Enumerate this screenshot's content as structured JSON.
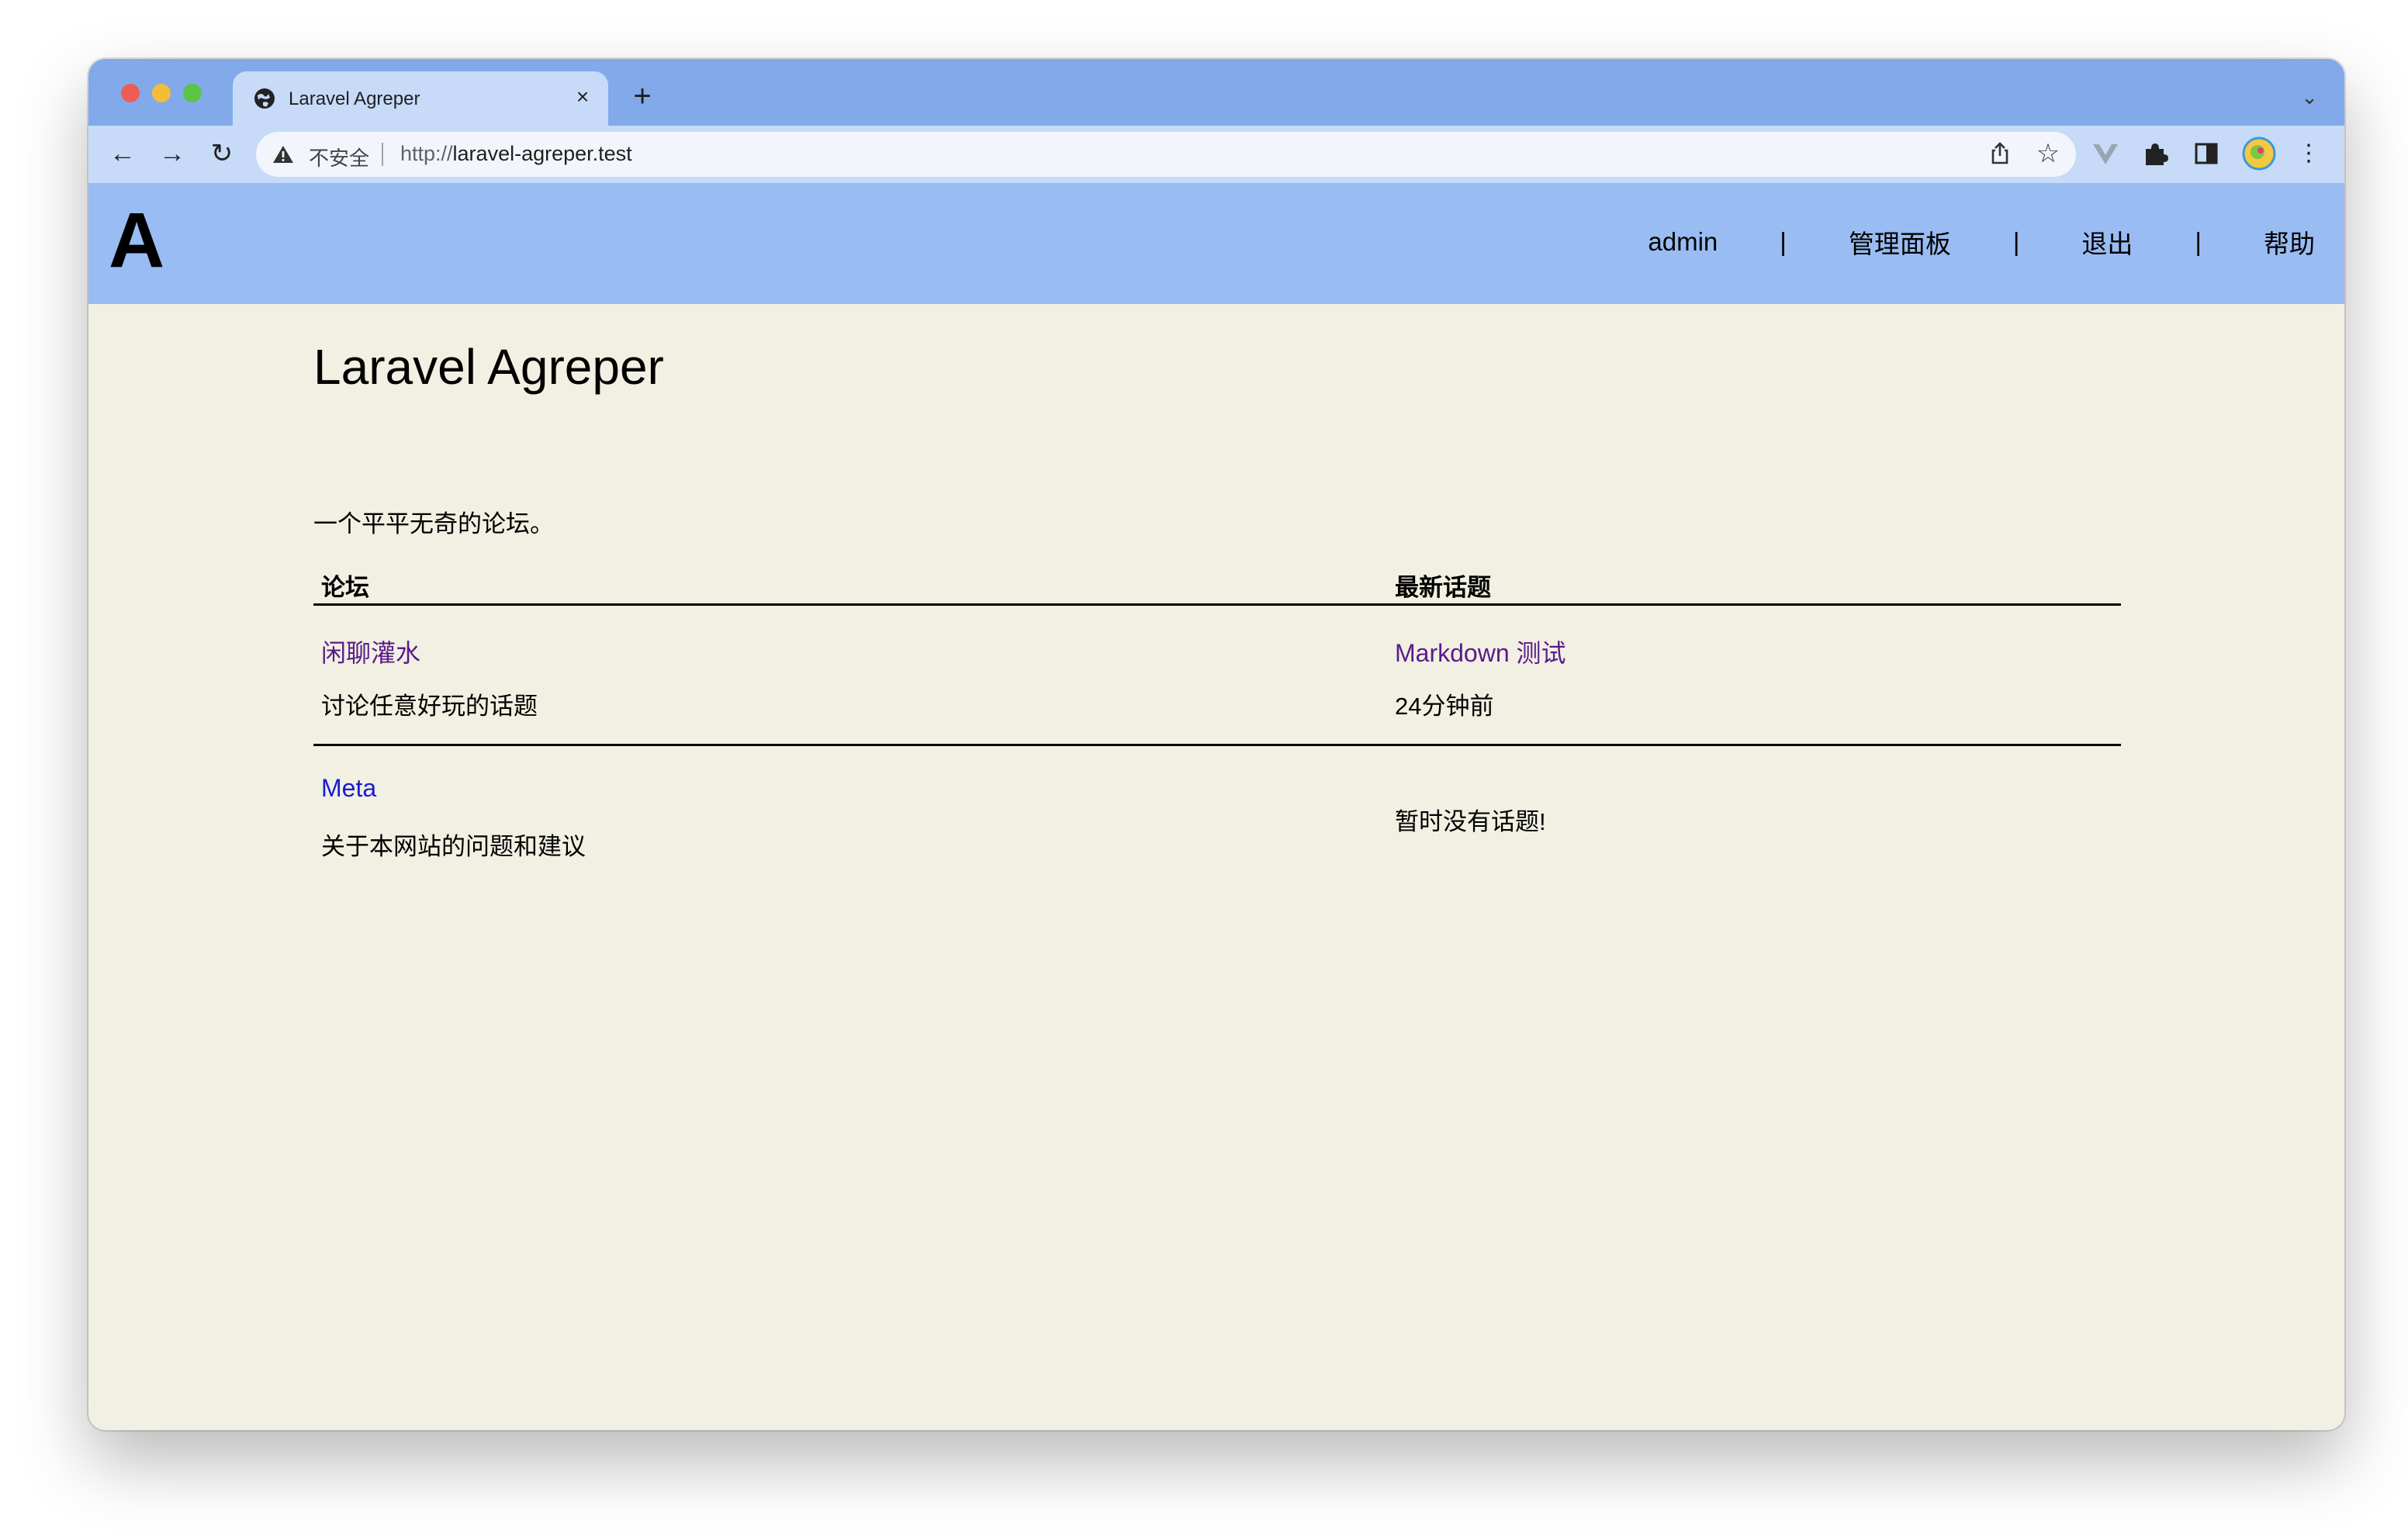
{
  "browser": {
    "tab_title": "Laravel Agreper",
    "tab_close": "×",
    "new_tab": "+",
    "address": {
      "security_label": "不安全",
      "url_scheme": "http://",
      "url_host": "laravel-agreper.test"
    }
  },
  "header": {
    "logo": "A",
    "nav": [
      {
        "label": "admin"
      },
      {
        "label": "管理面板"
      },
      {
        "label": "退出"
      },
      {
        "label": "帮助"
      }
    ],
    "separator": "|"
  },
  "main": {
    "title": "Laravel Agreper",
    "tagline": "一个平平无奇的论坛。",
    "columns": {
      "forum": "论坛",
      "latest": "最新话题"
    },
    "forums": [
      {
        "name": "闲聊灌水",
        "description": "讨论任意好玩的话题",
        "latest_title": "Markdown 测试",
        "latest_time": "24分钟前"
      },
      {
        "name": "Meta",
        "description": "关于本网站的问题和建议",
        "latest_empty": "暂时没有话题!"
      }
    ]
  },
  "colors": {
    "tabstrip": "#82aaea",
    "toolbar": "#c7dbf8",
    "site_header": "#99bcf2",
    "page_background": "#f1f0e2",
    "visited_link": "#5a1a8c",
    "link": "#1a1ad4"
  }
}
